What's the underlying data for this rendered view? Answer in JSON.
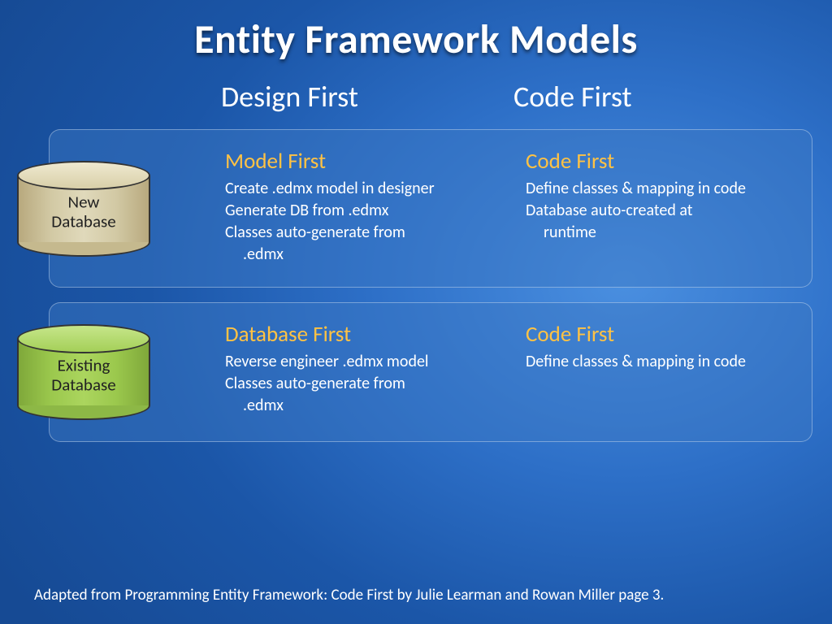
{
  "title": "Entity Framework Models",
  "columns": {
    "left": "Design First",
    "right": "Code First"
  },
  "rows": [
    {
      "cyl_label": "New\nDatabase",
      "cyl_color": "tan",
      "left_title": "Model First",
      "left_lines": [
        "Create .edmx model in designer",
        "Generate DB from .edmx",
        "Classes auto-generate from",
        "  .edmx"
      ],
      "right_title": "Code First",
      "right_lines": [
        "Define classes & mapping in code",
        "Database auto-created at",
        "  runtime"
      ]
    },
    {
      "cyl_label": "Existing\nDatabase",
      "cyl_color": "green",
      "left_title": "Database First",
      "left_lines": [
        "Reverse engineer .edmx model",
        "Classes auto-generate from",
        "  .edmx"
      ],
      "right_title": "Code First",
      "right_lines": [
        "Define classes & mapping in code"
      ]
    }
  ],
  "footnote": "Adapted from Programming Entity Framework: Code First by Julie Learman and Rowan Miller page 3."
}
